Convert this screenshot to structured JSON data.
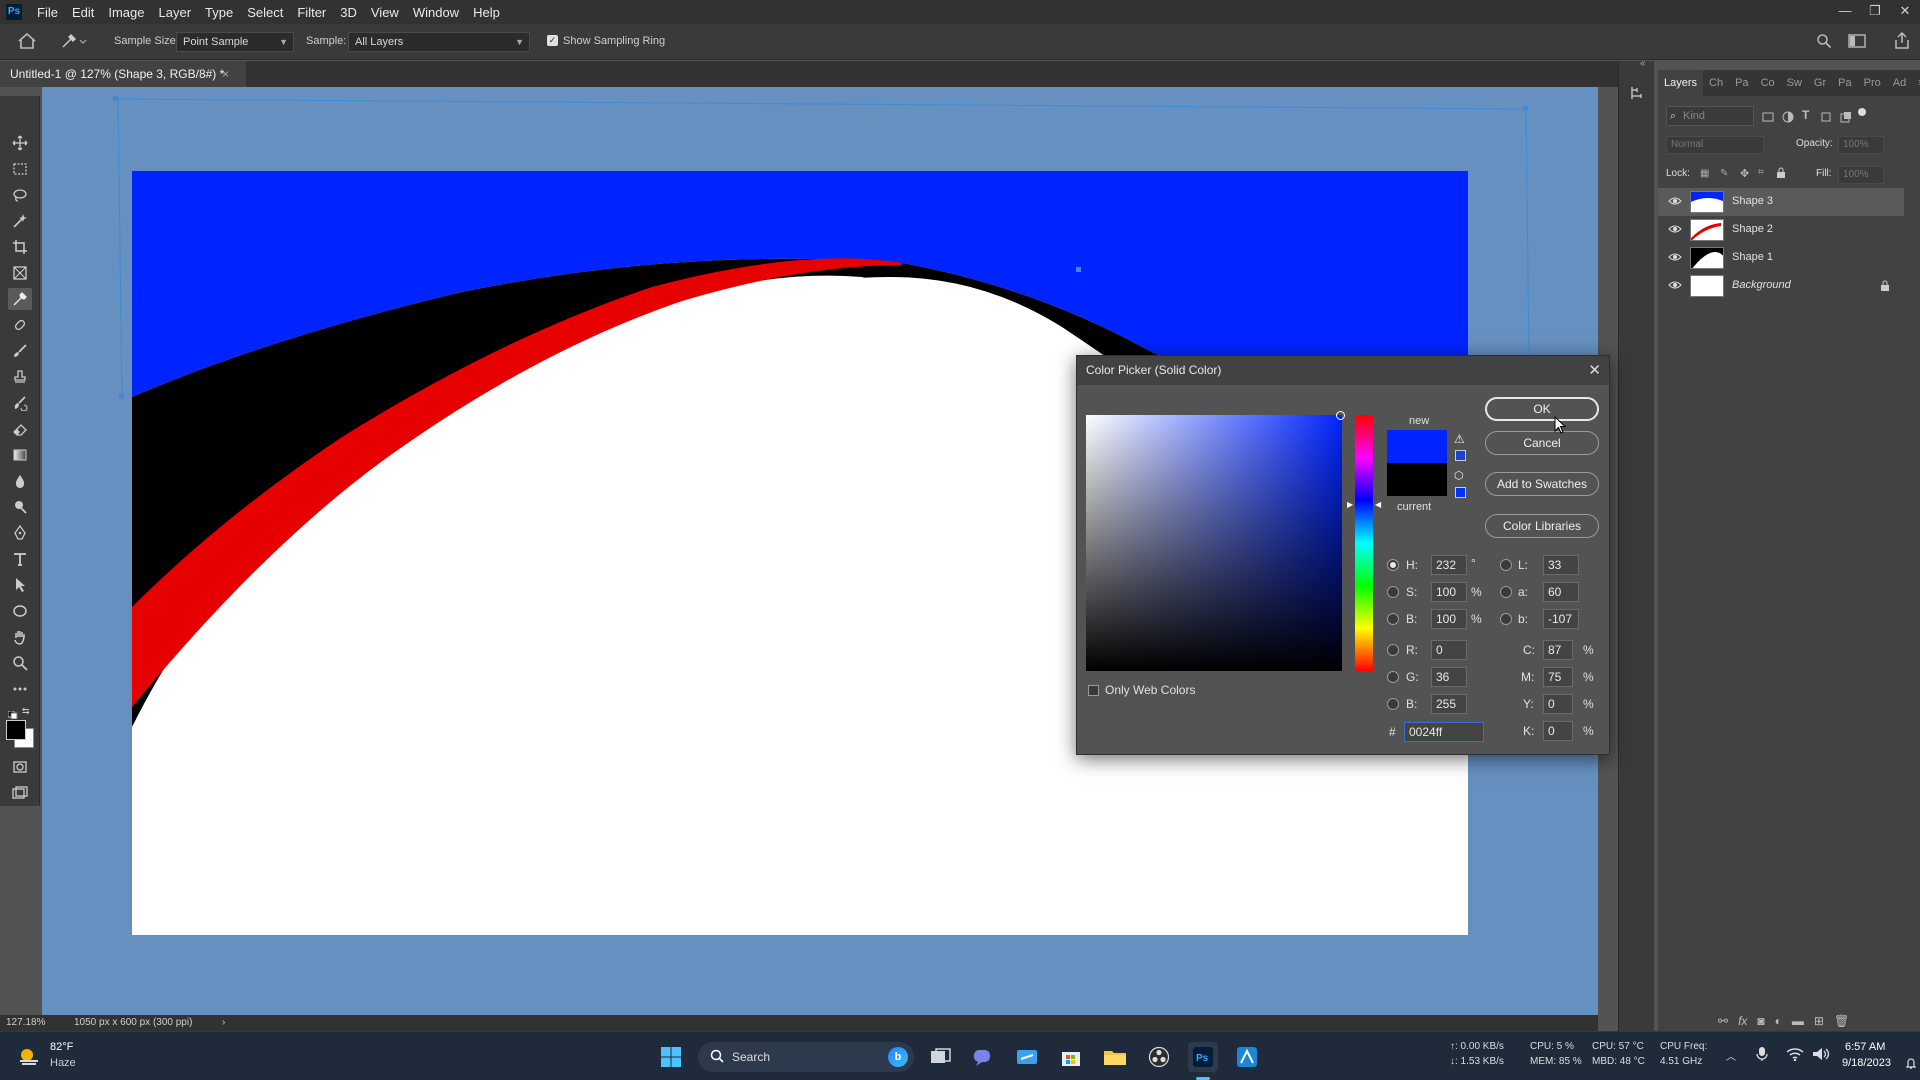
{
  "app": {
    "logo": "Ps",
    "menu": [
      "File",
      "Edit",
      "Image",
      "Layer",
      "Type",
      "Select",
      "Filter",
      "3D",
      "View",
      "Window",
      "Help"
    ],
    "window_controls": [
      "—",
      "❐",
      "✕"
    ]
  },
  "options_bar": {
    "sample_size_label": "Sample Size:",
    "sample_size_value": "Point Sample",
    "sample_label": "Sample:",
    "sample_value": "All Layers",
    "show_sampling_ring_label": "Show Sampling Ring",
    "show_sampling_ring_checked": true
  },
  "document": {
    "tab_title": "Untitled-1 @ 127% (Shape 3, RGB/8#) *",
    "tab_close": "×",
    "colors": {
      "canvas_bg": "#6590c0",
      "blue": "#0024ff",
      "red": "#e60000",
      "black": "#000000",
      "white": "#ffffff"
    }
  },
  "status": {
    "zoom": "127.18%",
    "doc_info": "1050 px x 600 px (300 ppi)",
    "arrow": "›"
  },
  "layers_panel": {
    "tabs": [
      "Layers",
      "Ch",
      "Pa",
      "Co",
      "Sw",
      "Gr",
      "Pa",
      "Pro",
      "Ad"
    ],
    "kind_placeholder": "Kind",
    "blend_mode": "Normal",
    "opacity_label": "Opacity:",
    "opacity_value": "100%",
    "lock_label": "Lock:",
    "fill_label": "Fill:",
    "fill_value": "100%",
    "layers": [
      {
        "name": "Shape 3",
        "selected": true,
        "locked": false
      },
      {
        "name": "Shape 2",
        "selected": false,
        "locked": false
      },
      {
        "name": "Shape 1",
        "selected": false,
        "locked": false
      },
      {
        "name": "Background",
        "selected": false,
        "locked": true
      }
    ]
  },
  "color_picker": {
    "title": "Color Picker (Solid Color)",
    "close": "✕",
    "ok_label": "OK",
    "cancel_label": "Cancel",
    "add_swatches_label": "Add to Swatches",
    "color_libraries_label": "Color Libraries",
    "new_label": "new",
    "current_label": "current",
    "new_color": "#0024ff",
    "current_color": "#000000",
    "only_web_colors_label": "Only Web Colors",
    "only_web_colors_checked": false,
    "hsb": {
      "h_label": "H:",
      "h_value": "232",
      "h_unit": "°",
      "s_label": "S:",
      "s_value": "100",
      "s_unit": "%",
      "b_label": "B:",
      "b_value": "100",
      "b_unit": "%"
    },
    "lab": {
      "l_label": "L:",
      "l_value": "33",
      "a_label": "a:",
      "a_value": "60",
      "b_label": "b:",
      "b_value": "-107"
    },
    "rgb": {
      "r_label": "R:",
      "r_value": "0",
      "g_label": "G:",
      "g_value": "36",
      "b_label": "B:",
      "b_value": "255"
    },
    "cmyk": {
      "c_label": "C:",
      "c_value": "87",
      "m_label": "M:",
      "m_value": "75",
      "y_label": "Y:",
      "y_value": "0",
      "k_label": "K:",
      "k_value": "0",
      "unit": "%"
    },
    "hex_label": "#",
    "hex_value": "0024ff"
  },
  "taskbar": {
    "weather_temp": "82°F",
    "weather_desc": "Haze",
    "search_label": "Search",
    "net_up": "↑: 0.00 KB/s",
    "net_down": "↓: 1.53 KB/s",
    "cpu": "CPU: 5 %",
    "mem": "MEM: 85 %",
    "cpu_temp": "CPU: 57 °C",
    "mbd_temp": "MBD: 48 °C",
    "cpu_freq_label": "CPU Freq:",
    "cpu_freq_value": "4.51 GHz",
    "time": "6:57 AM",
    "date": "9/18/2023"
  }
}
